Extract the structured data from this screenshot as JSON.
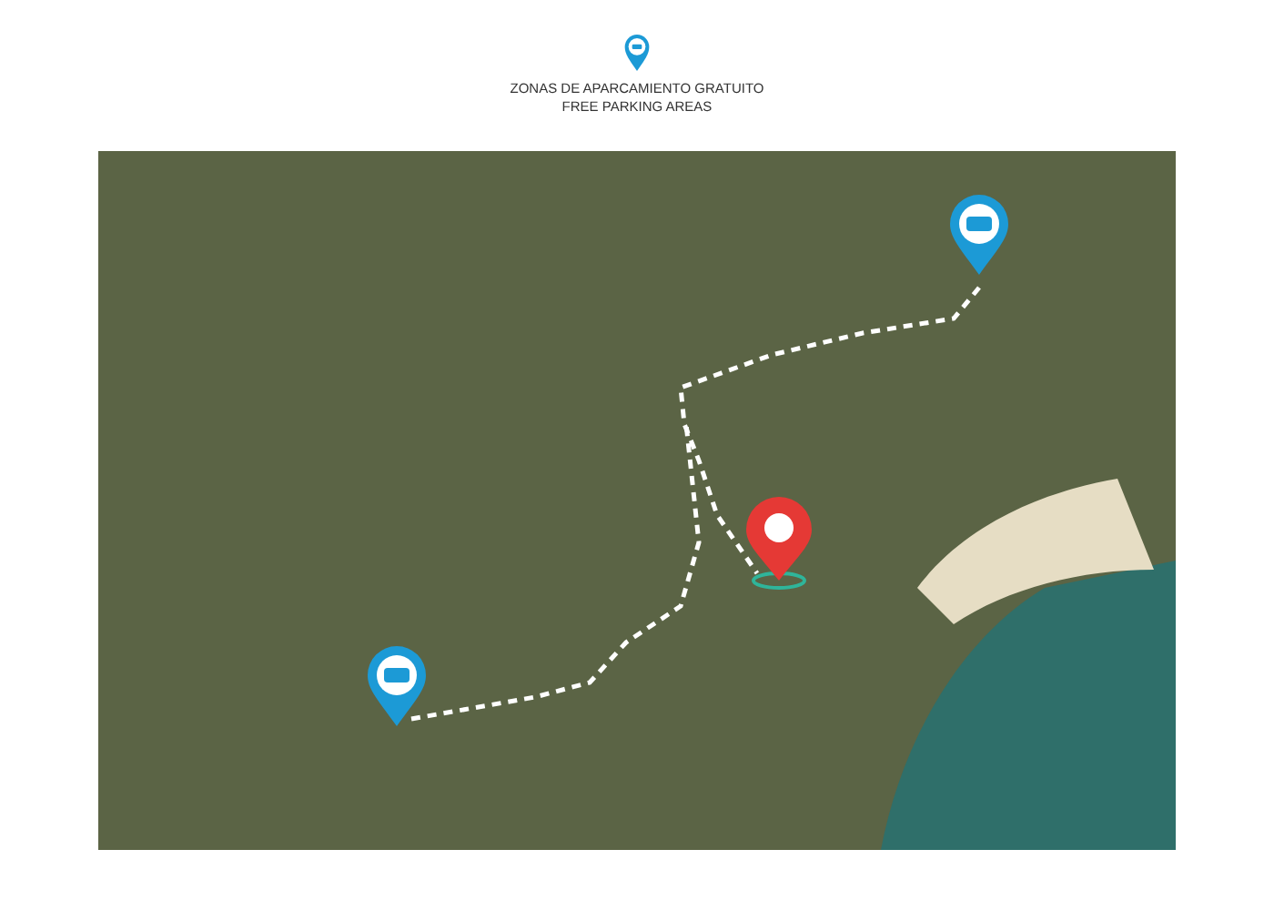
{
  "legend": {
    "lines": [
      "ZONAS DE APARCAMIENTO GRATUITO",
      "FREE PARKING AREAS"
    ]
  }
}
